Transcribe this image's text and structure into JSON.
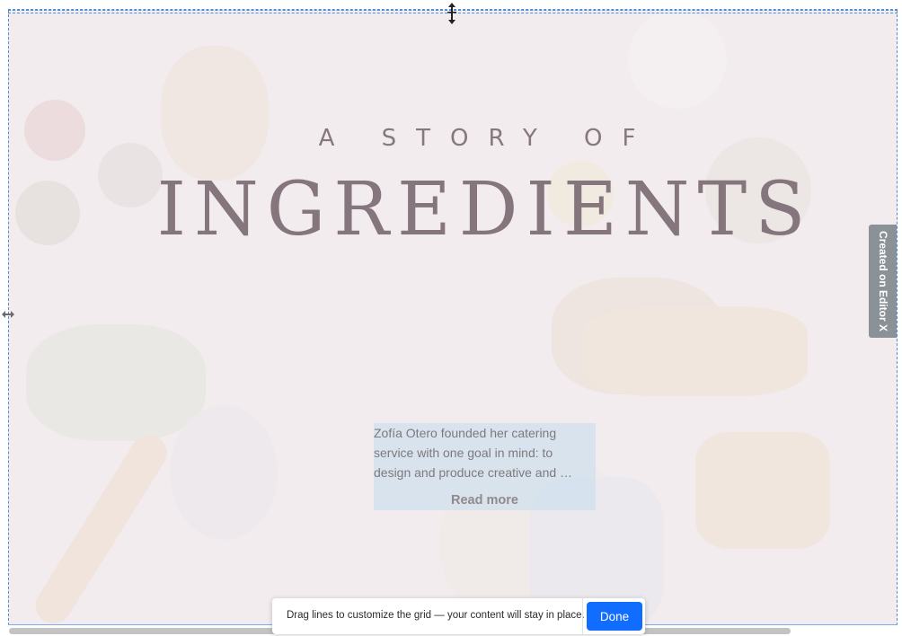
{
  "hero": {
    "eyebrow": "A STORY OF",
    "title": "INGREDIENTS",
    "description_lines": [
      "Zofía Otero founded her catering",
      "service with one goal in mind: to",
      "design and produce creative and …"
    ],
    "read_more": "Read more"
  },
  "side_badge": {
    "label": "Created on Editor X"
  },
  "toast": {
    "message": "Drag lines to customize the grid — your content will stay in place.",
    "done_label": "Done"
  },
  "icons": {
    "top_handle": "vertical-resize-icon",
    "left_handle": "horizontal-resize-icon"
  },
  "colors": {
    "grid_line": "#4a8fdc",
    "title_text": "#85757d",
    "text_box_highlight": "#c4dcec",
    "done_button": "#116dff",
    "side_badge": "#8a9197"
  }
}
